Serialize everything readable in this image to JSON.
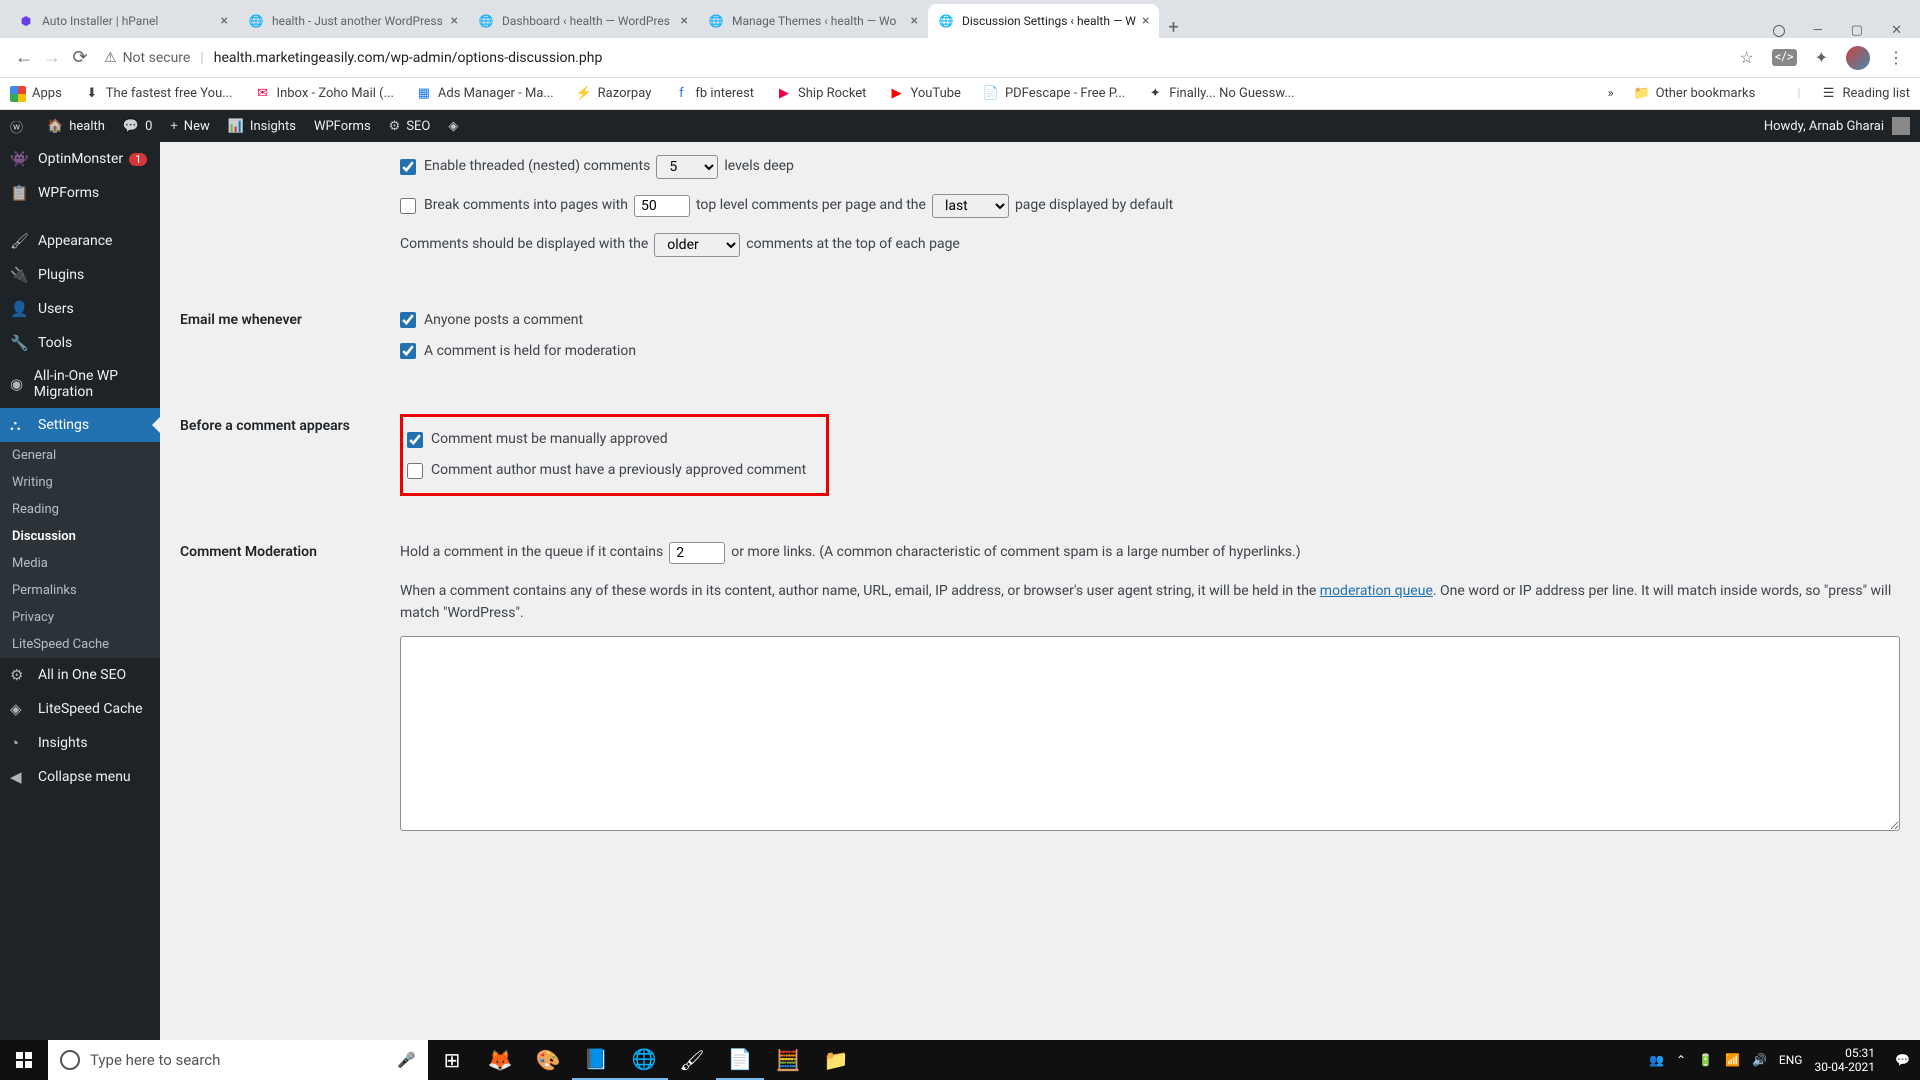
{
  "tabs": [
    {
      "title": "Auto Installer | hPanel"
    },
    {
      "title": "health - Just another WordPress"
    },
    {
      "title": "Dashboard ‹ health — WordPres"
    },
    {
      "title": "Manage Themes ‹ health — Wo"
    },
    {
      "title": "Discussion Settings ‹ health — W"
    }
  ],
  "url": {
    "not_secure": "Not secure",
    "path": "health.marketingeasily.com/wp-admin/options-discussion.php"
  },
  "bookmarks": {
    "apps": "Apps",
    "items": [
      "The fastest free You...",
      "Inbox - Zoho Mail (...",
      "Ads Manager - Ma...",
      "Razorpay",
      "fb interest",
      "Ship Rocket",
      "YouTube",
      "PDFescape - Free P...",
      "Finally... No Guessw..."
    ],
    "other": "Other bookmarks",
    "reading": "Reading list"
  },
  "adminbar": {
    "site": "health",
    "comments": "0",
    "new": "New",
    "insights": "Insights",
    "wpforms": "WPForms",
    "seo": "SEO",
    "howdy": "Howdy, Arnab Gharai"
  },
  "sidebar": {
    "optinmonster": "OptinMonster",
    "optinmonster_badge": "1",
    "wpforms": "WPForms",
    "appearance": "Appearance",
    "plugins": "Plugins",
    "users": "Users",
    "tools": "Tools",
    "migration": "All-in-One WP Migration",
    "settings": "Settings",
    "sub": {
      "general": "General",
      "writing": "Writing",
      "reading": "Reading",
      "discussion": "Discussion",
      "media": "Media",
      "permalinks": "Permalinks",
      "privacy": "Privacy",
      "litespeed": "LiteSpeed Cache"
    },
    "aioseo": "All in One SEO",
    "litespeed": "LiteSpeed Cache",
    "insights": "Insights",
    "collapse": "Collapse menu"
  },
  "settings": {
    "threaded_label": "Enable threaded (nested) comments",
    "threaded_levels": "5",
    "threaded_suffix": "levels deep",
    "break_label": "Break comments into pages with",
    "break_value": "50",
    "break_mid": "top level comments per page and the",
    "break_select": "last",
    "break_suffix": "page displayed by default",
    "order_prefix": "Comments should be displayed with the",
    "order_select": "older",
    "order_suffix": "comments at the top of each page",
    "email_heading": "Email me whenever",
    "email_anyone": "Anyone posts a comment",
    "email_held": "A comment is held for moderation",
    "before_heading": "Before a comment appears",
    "before_manual": "Comment must be manually approved",
    "before_prev": "Comment author must have a previously approved comment",
    "mod_heading": "Comment Moderation",
    "mod_prefix": "Hold a comment in the queue if it contains",
    "mod_value": "2",
    "mod_suffix": "or more links. (A common characteristic of comment spam is a large number of hyperlinks.)",
    "mod_desc1": "When a comment contains any of these words in its content, author name, URL, email, IP address, or browser's user agent string, it will be held in the ",
    "mod_link": "moderation queue",
    "mod_desc2": ". One word or IP address per line. It will match inside words, so \"press\" will match \"WordPress\"."
  },
  "taskbar": {
    "search": "Type here to search",
    "lang": "ENG",
    "time": "05:31",
    "date": "30-04-2021"
  }
}
